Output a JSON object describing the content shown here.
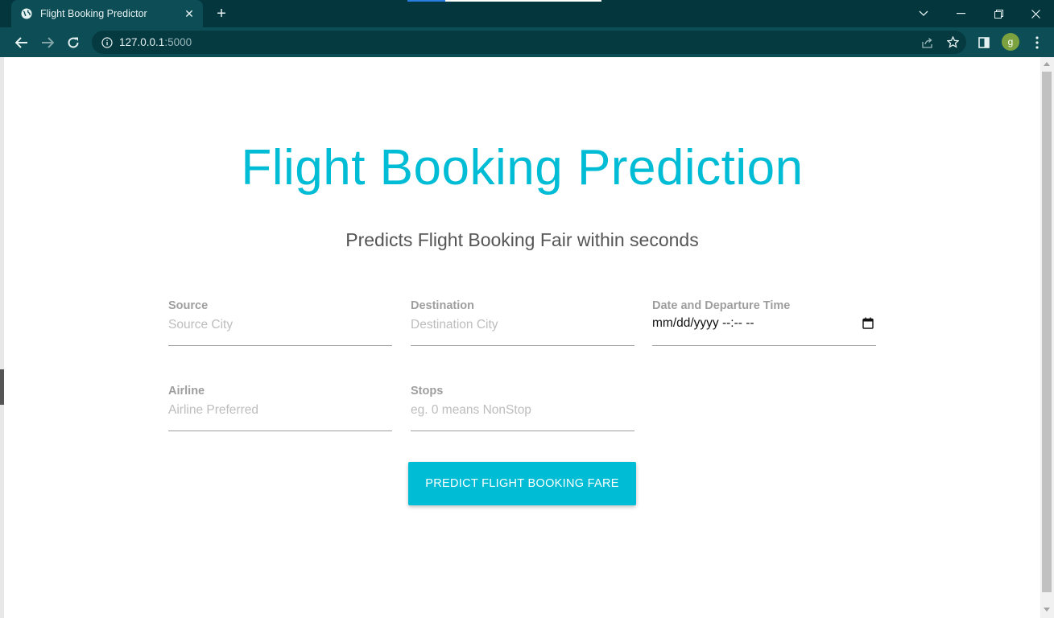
{
  "browser": {
    "tab_title": "Flight Booking Predictor",
    "url_host": "127.0.0.1",
    "url_port": ":5000",
    "avatar_letter": "g",
    "theme_color": "#0d4d55"
  },
  "page": {
    "title": "Flight Booking Prediction",
    "subtitle": "Predicts Flight Booking Fair within seconds",
    "accent_color": "#00bcd4"
  },
  "form": {
    "source": {
      "label": "Source",
      "placeholder": "Source City",
      "value": ""
    },
    "destination": {
      "label": "Destination",
      "placeholder": "Destination City",
      "value": ""
    },
    "departure": {
      "label": "Date and Departure Time",
      "value": "mm/dd/yyyy --:-- --"
    },
    "airline": {
      "label": "Airline",
      "placeholder": "Airline Preferred",
      "value": ""
    },
    "stops": {
      "label": "Stops",
      "placeholder": "eg. 0 means NonStop",
      "value": ""
    },
    "submit_label": "Predict Flight Booking Fare"
  }
}
